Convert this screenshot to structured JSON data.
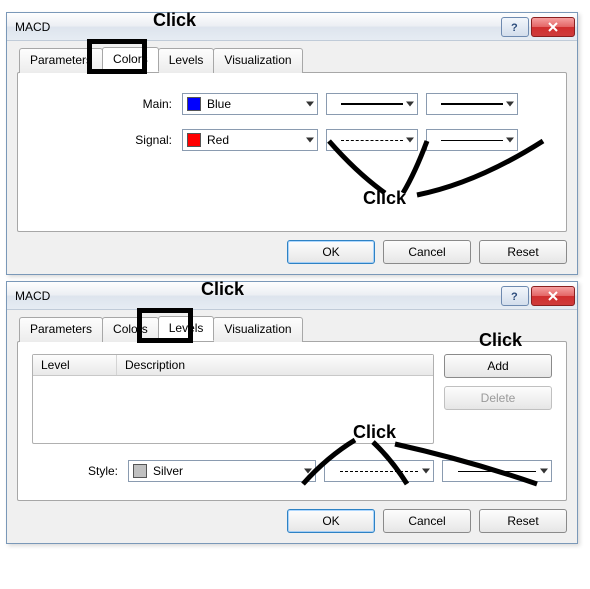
{
  "dialog1": {
    "title": "MACD",
    "tabs": [
      "Parameters",
      "Colors",
      "Levels",
      "Visualization"
    ],
    "active_tab": "Colors",
    "rows": {
      "main": {
        "label": "Main:",
        "color_name": "Blue",
        "swatch": "#0000ff"
      },
      "signal": {
        "label": "Signal:",
        "color_name": "Red",
        "swatch": "#ff0000"
      }
    },
    "buttons": {
      "ok": "OK",
      "cancel": "Cancel",
      "reset": "Reset"
    }
  },
  "dialog2": {
    "title": "MACD",
    "tabs": [
      "Parameters",
      "Colors",
      "Levels",
      "Visualization"
    ],
    "active_tab": "Levels",
    "list": {
      "col_level": "Level",
      "col_desc": "Description"
    },
    "side": {
      "add": "Add",
      "delete": "Delete"
    },
    "style": {
      "label": "Style:",
      "color_name": "Silver",
      "swatch": "#c0c0c0"
    },
    "buttons": {
      "ok": "OK",
      "cancel": "Cancel",
      "reset": "Reset"
    }
  },
  "annotations": {
    "click": "Click"
  }
}
